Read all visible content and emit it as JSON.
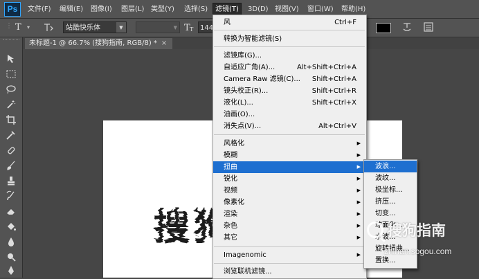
{
  "app": {
    "logo": "Ps"
  },
  "menubar": {
    "items": [
      {
        "label": "文件(F)"
      },
      {
        "label": "编辑(E)"
      },
      {
        "label": "图像(I)"
      },
      {
        "label": "图层(L)"
      },
      {
        "label": "类型(Y)"
      },
      {
        "label": "选择(S)"
      },
      {
        "label": "滤镜(T)"
      },
      {
        "label": "3D(D)"
      },
      {
        "label": "视图(V)"
      },
      {
        "label": "窗口(W)"
      },
      {
        "label": "帮助(H)"
      }
    ]
  },
  "options": {
    "type_icon": "T",
    "font_family": "站酷快乐体",
    "font_style": "",
    "font_size": "144",
    "text_color": "#000000"
  },
  "document": {
    "tab_label": "未标题-1 @ 66.7% (搜狗指南, RGB/8) *",
    "close_glyph": "×",
    "canvas_text": "搜狗"
  },
  "filter_menu": {
    "last_filter": {
      "label": "风",
      "shortcut": "Ctrl+F"
    },
    "smart_filters": {
      "label": "转换为智能滤镜(S)"
    },
    "group1": [
      {
        "label": "滤镜库(G)...",
        "shortcut": ""
      },
      {
        "label": "自适应广角(A)...",
        "shortcut": "Alt+Shift+Ctrl+A"
      },
      {
        "label": "Camera Raw 滤镜(C)...",
        "shortcut": "Shift+Ctrl+A"
      },
      {
        "label": "镜头校正(R)...",
        "shortcut": "Shift+Ctrl+R"
      },
      {
        "label": "液化(L)...",
        "shortcut": "Shift+Ctrl+X"
      },
      {
        "label": "油画(O)...",
        "shortcut": ""
      },
      {
        "label": "消失点(V)...",
        "shortcut": "Alt+Ctrl+V"
      }
    ],
    "group2": [
      {
        "label": "风格化"
      },
      {
        "label": "模糊"
      },
      {
        "label": "扭曲"
      },
      {
        "label": "锐化"
      },
      {
        "label": "视频"
      },
      {
        "label": "像素化"
      },
      {
        "label": "渲染"
      },
      {
        "label": "杂色"
      },
      {
        "label": "其它"
      }
    ],
    "imagenomic": {
      "label": "Imagenomic"
    },
    "browse": {
      "label": "浏览联机滤镜..."
    }
  },
  "distort_submenu": {
    "items": [
      {
        "label": "波浪..."
      },
      {
        "label": "波纹..."
      },
      {
        "label": "极坐标..."
      },
      {
        "label": "挤压..."
      },
      {
        "label": "切变..."
      },
      {
        "label": "球面化..."
      },
      {
        "label": "水波..."
      },
      {
        "label": "旋转扭曲..."
      },
      {
        "label": "置换..."
      }
    ]
  },
  "watermark": {
    "title": "搜狗指南",
    "url": "zhinan.sogou.com"
  },
  "colors": {
    "highlight": "#1e6fd0",
    "menu_bg": "#efefef",
    "app_bg": "#535353"
  }
}
